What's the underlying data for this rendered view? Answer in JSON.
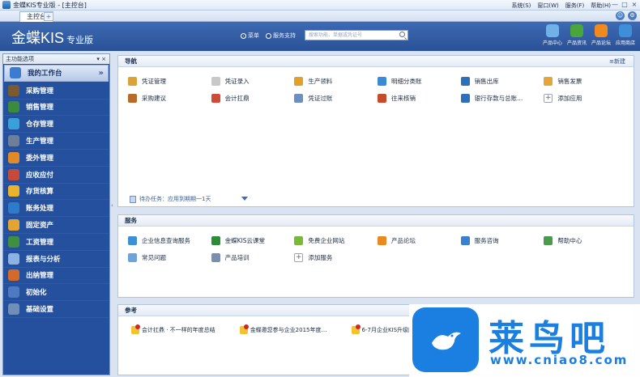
{
  "window": {
    "title": "金蝶KIS专业版 - [主控台]",
    "menus": [
      "系统(S)",
      "窗口(W)",
      "服务(F)",
      "帮助(H)"
    ],
    "controls": [
      "—",
      "□",
      "×"
    ]
  },
  "tabs": {
    "active": "主控台",
    "add": "+"
  },
  "header": {
    "brand": "金蝶KIS",
    "edition": "专业版",
    "radio_options": [
      "菜单",
      "服务支持"
    ],
    "search_placeholder": "搜索功能、单据或凭证号",
    "tools": [
      {
        "label": "产品中心",
        "color": "#6fb1e8"
      },
      {
        "label": "产品资讯",
        "color": "#4aa63c"
      },
      {
        "label": "产品论坛",
        "color": "#f08a1f"
      },
      {
        "label": "应用商店",
        "color": "#3e8fd8"
      }
    ]
  },
  "sidebar": {
    "title": "主功能选项",
    "pin": "▾ ×",
    "items": [
      {
        "label": "我的工作台",
        "icon": "workbench-icon",
        "color": "#3b7bd0"
      },
      {
        "label": "采购管理",
        "icon": "purchase-icon",
        "color": "#7a5a2e"
      },
      {
        "label": "销售管理",
        "icon": "sales-icon",
        "color": "#3c8a3c"
      },
      {
        "label": "仓存管理",
        "icon": "warehouse-icon",
        "color": "#3aa0d8"
      },
      {
        "label": "生产管理",
        "icon": "production-icon",
        "color": "#6d7f99"
      },
      {
        "label": "委外管理",
        "icon": "outsourcing-icon",
        "color": "#e08a2a"
      },
      {
        "label": "应收应付",
        "icon": "receivable-icon",
        "color": "#c64a3a"
      },
      {
        "label": "存货核算",
        "icon": "inventory-icon",
        "color": "#e9b32c"
      },
      {
        "label": "账务处理",
        "icon": "accounting-icon",
        "color": "#2d7bc9"
      },
      {
        "label": "固定资产",
        "icon": "fixed-asset-icon",
        "color": "#e3a532"
      },
      {
        "label": "工资管理",
        "icon": "payroll-icon",
        "color": "#3f8f3f"
      },
      {
        "label": "报表与分析",
        "icon": "report-icon",
        "color": "#8bb2e3"
      },
      {
        "label": "出纳管理",
        "icon": "cashier-icon",
        "color": "#d46a2a"
      },
      {
        "label": "初始化",
        "icon": "init-icon",
        "color": "#4f79c0"
      },
      {
        "label": "基础设置",
        "icon": "settings-icon",
        "color": "#6f8fb8"
      }
    ]
  },
  "nav_panel": {
    "title": "导航",
    "new_label": "≡新建",
    "items": [
      {
        "label": "凭证管理",
        "icon": "voucher-icon",
        "color": "#d9a23a"
      },
      {
        "label": "凭证录入",
        "icon": "voucher-entry-icon",
        "color": "#c8c8c8"
      },
      {
        "label": "生产领料",
        "icon": "material-icon",
        "color": "#e0a02a"
      },
      {
        "label": "明细分类账",
        "icon": "ledger-icon",
        "color": "#3a8ad6"
      },
      {
        "label": "销售出库",
        "icon": "outbound-icon",
        "color": "#2d6fb8"
      },
      {
        "label": "销售发票",
        "icon": "invoice-icon",
        "color": "#e4a53a"
      },
      {
        "label": "采购建议",
        "icon": "suggest-icon",
        "color": "#b86a2a"
      },
      {
        "label": "会计扛鼎",
        "icon": "accountant-icon",
        "color": "#d04a3a"
      },
      {
        "label": "凭证过账",
        "icon": "posting-icon",
        "color": "#6a8fc0"
      },
      {
        "label": "往来核销",
        "icon": "reconcile-icon",
        "color": "#c84a2a"
      },
      {
        "label": "银行存款与总账...",
        "icon": "bank-icon",
        "color": "#2d6fb8"
      },
      {
        "label": "添加应用",
        "icon": "add-icon",
        "color": "#ffffff"
      }
    ],
    "todo_label": "待办任务：应用到期期一1天"
  },
  "service_panel": {
    "title": "服务",
    "items": [
      {
        "label": "企业信息查询服务",
        "icon": "enterprise-info-icon",
        "color": "#3d8fd6"
      },
      {
        "label": "金蝶KIS云课堂",
        "icon": "cloud-class-icon",
        "color": "#2e8b3a"
      },
      {
        "label": "免费企业网站",
        "icon": "website-icon",
        "color": "#7ab83a"
      },
      {
        "label": "产品论坛",
        "icon": "forum-icon",
        "color": "#e88a1f"
      },
      {
        "label": "服务咨询",
        "icon": "consult-icon",
        "color": "#3a7fd0"
      },
      {
        "label": "帮助中心",
        "icon": "help-icon",
        "color": "#4c9a4c"
      },
      {
        "label": "常见问题",
        "icon": "faq-icon",
        "color": "#6da3da"
      },
      {
        "label": "产品培训",
        "icon": "training-icon",
        "color": "#7a8fb0"
      },
      {
        "label": "添加服务",
        "icon": "add-service-icon",
        "color": "#ffffff"
      }
    ]
  },
  "ref_panel": {
    "title": "参考",
    "items": [
      "会计扛鼎 · 不一样的年度总结",
      "金蝶邀您参与企业2015年度…",
      "6-7月企业KIS升级同量…"
    ]
  },
  "watermark": {
    "text": "莱鸟吧",
    "url": "www.cniao8.com"
  }
}
